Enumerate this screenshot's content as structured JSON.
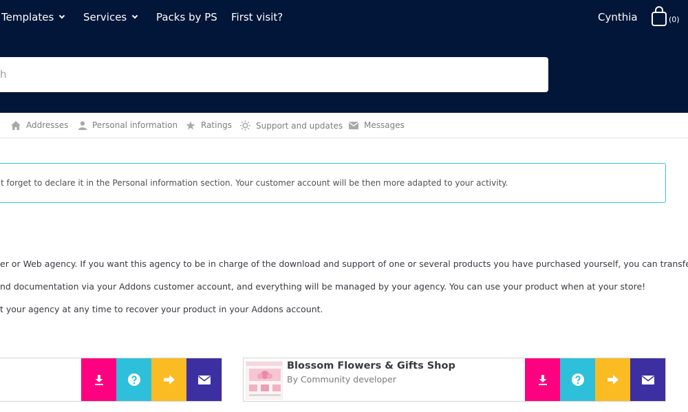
{
  "header": {
    "nav": [
      {
        "label": "Templates",
        "dropdown": true
      },
      {
        "label": "Services",
        "dropdown": true
      },
      {
        "label": "Packs by PS",
        "dropdown": false
      },
      {
        "label": "First visit?",
        "dropdown": false
      }
    ],
    "user_name": "Cynthia",
    "cart_count": "(0)"
  },
  "search": {
    "text": "h"
  },
  "tabs": [
    {
      "label": "Addresses",
      "icon": "home-icon"
    },
    {
      "label": "Personal information",
      "icon": "person-icon"
    },
    {
      "label": "Ratings",
      "icon": "star-icon"
    },
    {
      "label": "Support and updates",
      "icon": "sun-icon"
    },
    {
      "label": "Messages",
      "icon": "envelope-icon"
    }
  ],
  "alert": {
    "text": "t forget to declare it in the Personal information section. Your customer account will be then more adapted to your activity."
  },
  "paragraphs": [
    "er or Web agency. If you want this agency to be in charge of the download and support of one or several products you have purchased yourself, you can transfer them.",
    "nd documentation via your Addons customer account, and everything will be managed by your agency. You can use your product when at your store!",
    "t your agency at any time to recover your product in your Addons account."
  ],
  "products": [
    {
      "title": "",
      "subtitle": ""
    },
    {
      "title": "Blossom Flowers & Gifts Shop",
      "subtitle": "By Community developer"
    }
  ],
  "colors": {
    "header_bg": "#011638",
    "download": "#ff0080",
    "help": "#2ebfdb",
    "transfer": "#fbbb22",
    "contact": "#3c2fa1",
    "alert_border": "#33c2de"
  }
}
